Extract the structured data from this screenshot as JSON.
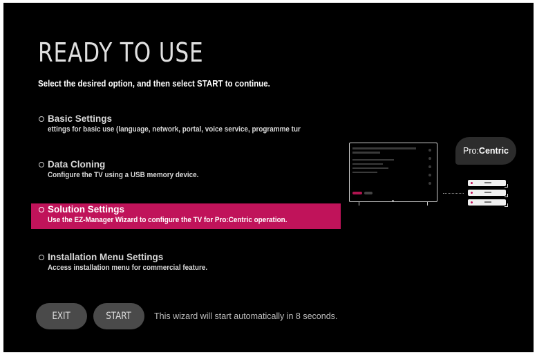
{
  "header": {
    "title": "READY TO USE",
    "subtitle": "Select the desired option, and then select START to continue."
  },
  "options": [
    {
      "name": "Basic Settings",
      "desc": "ettings for basic use (language, network, portal, voice service, programme tur",
      "selected": false
    },
    {
      "name": "Data Cloning",
      "desc": "Configure the TV using a USB memory device.",
      "selected": false
    },
    {
      "name": "Solution Settings",
      "desc": "Use the EZ-Manager Wizard to configure the TV for Pro:Centric operation.",
      "selected": true
    },
    {
      "name": "Installation Menu Settings",
      "desc": "Access installation menu for commercial feature.",
      "selected": false
    }
  ],
  "buttons": {
    "exit_label": "EXIT",
    "start_label": "START"
  },
  "countdown_text": "This wizard will start automatically in 8 seconds.",
  "illustration": {
    "badge_prefix": "Pro:",
    "badge_brand": "Centric"
  },
  "colors": {
    "background": "#000000",
    "accent": "#c0135a",
    "button": "#4a4a4a"
  }
}
